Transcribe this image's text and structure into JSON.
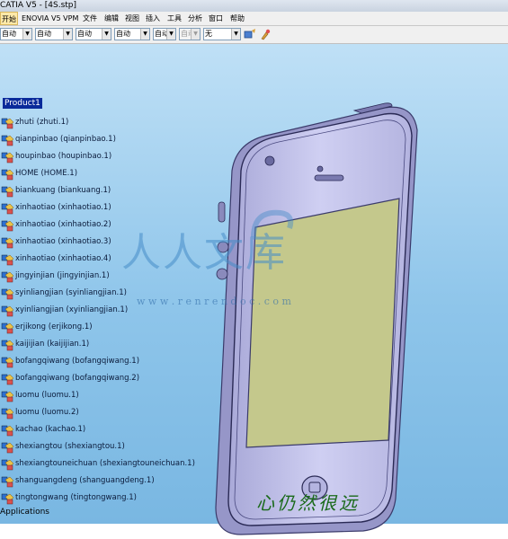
{
  "window": {
    "title": "CATIA V5 - [4S.stp]"
  },
  "menu": [
    "开始",
    "ENOVIA V5 VPM",
    "文件",
    "编辑",
    "视图",
    "插入",
    "工具",
    "分析",
    "窗口",
    "帮助"
  ],
  "toolbar": {
    "combos": [
      "自动",
      "自动",
      "自动",
      "自动",
      "自动",
      "自动",
      "自动",
      "无"
    ],
    "icons": [
      "paint-format-icon",
      "brush-icon"
    ]
  },
  "tree": {
    "root": "Product1",
    "items": [
      "zhuti (zhuti.1)",
      "qianpinbao (qianpinbao.1)",
      "houpinbao (houpinbao.1)",
      "HOME (HOME.1)",
      "biankuang (biankuang.1)",
      "xinhaotiao (xinhaotiao.1)",
      "xinhaotiao (xinhaotiao.2)",
      "xinhaotiao (xinhaotiao.3)",
      "xinhaotiao (xinhaotiao.4)",
      "jingyinjian (jingyinjian.1)",
      "syinliangjian (syinliangjian.1)",
      "xyinliangjian (xyinliangjian.1)",
      "erjikong (erjikong.1)",
      "kaijijian (kaijijian.1)",
      "bofangqiwang (bofangqiwang.1)",
      "bofangqiwang (bofangqiwang.2)",
      "luomu (luomu.1)",
      "luomu (luomu.2)",
      "kachao (kachao.1)",
      "shexiangtou (shexiangtou.1)",
      "shexiangtouneichuan (shexiangtouneichuan.1)",
      "shanguangdeng (shanguangdeng.1)",
      "tingtongwang (tingtongwang.1)"
    ],
    "applications": "Applications"
  },
  "watermark": {
    "brand": "人人文库",
    "url": "w w w . r e n r e n d o c . c o m",
    "slogan": "心仍然很远"
  },
  "colors": {
    "selection": "#0a2a9a",
    "viewport_top": "#bfe0f6",
    "viewport_bottom": "#79b7e2",
    "screen": "#c4c88c",
    "body": "#c8c8ee"
  }
}
